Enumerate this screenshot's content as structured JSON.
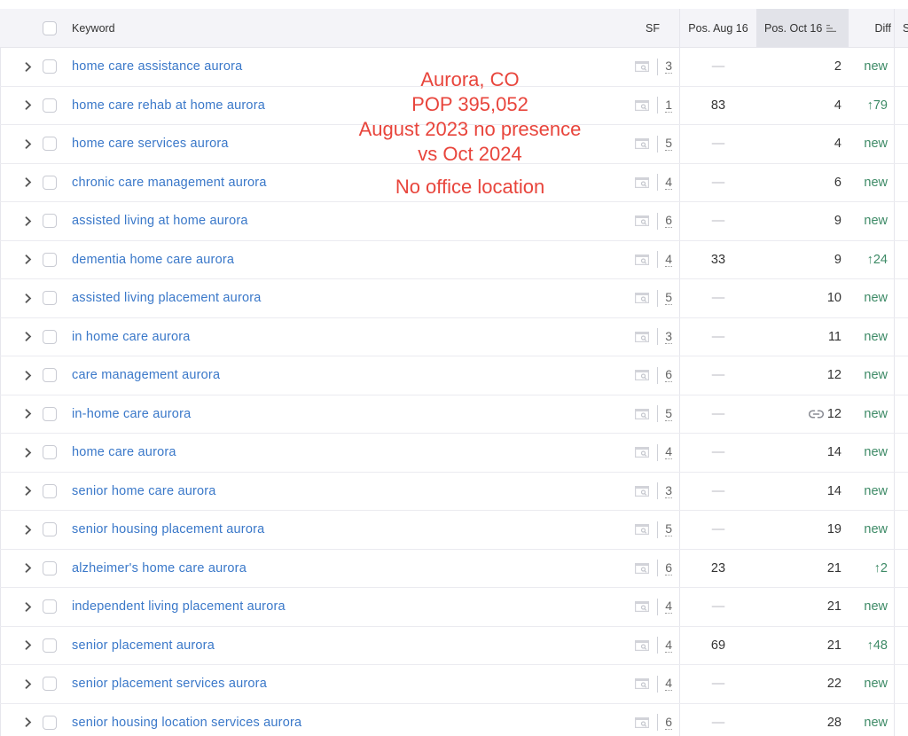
{
  "header": {
    "keyword": "Keyword",
    "sf": "SF",
    "pos_prev": "Pos. Aug 16",
    "pos_curr": "Pos. Oct 16",
    "diff": "Diff",
    "next_col": "S"
  },
  "annotation": {
    "lines": [
      "Aurora, CO",
      "POP 395,052",
      "August 2023 no presence",
      "vs Oct 2024"
    ],
    "note": "No office location",
    "color": "#e8453c"
  },
  "colors": {
    "keyword_link": "#3a78c9",
    "diff_positive": "#3d8a66",
    "header_bg": "#f4f4f8",
    "sorted_header_bg": "#e2e3e9"
  },
  "rows": [
    {
      "keyword": "home care assistance aurora",
      "sf": "3",
      "prev": "—",
      "curr": "2",
      "diff": "new",
      "link": false
    },
    {
      "keyword": "home care rehab at home aurora",
      "sf": "1",
      "prev": "83",
      "curr": "4",
      "diff": "↑79",
      "link": false
    },
    {
      "keyword": "home care services aurora",
      "sf": "5",
      "prev": "—",
      "curr": "4",
      "diff": "new",
      "link": false
    },
    {
      "keyword": "chronic care management aurora",
      "sf": "4",
      "prev": "—",
      "curr": "6",
      "diff": "new",
      "link": false
    },
    {
      "keyword": "assisted living at home aurora",
      "sf": "6",
      "prev": "—",
      "curr": "9",
      "diff": "new",
      "link": false
    },
    {
      "keyword": "dementia home care aurora",
      "sf": "4",
      "prev": "33",
      "curr": "9",
      "diff": "↑24",
      "link": false
    },
    {
      "keyword": "assisted living placement aurora",
      "sf": "5",
      "prev": "—",
      "curr": "10",
      "diff": "new",
      "link": false
    },
    {
      "keyword": "in home care aurora",
      "sf": "3",
      "prev": "—",
      "curr": "11",
      "diff": "new",
      "link": false
    },
    {
      "keyword": "care management aurora",
      "sf": "6",
      "prev": "—",
      "curr": "12",
      "diff": "new",
      "link": false
    },
    {
      "keyword": "in-home care aurora",
      "sf": "5",
      "prev": "—",
      "curr": "12",
      "diff": "new",
      "link": true
    },
    {
      "keyword": "home care aurora",
      "sf": "4",
      "prev": "—",
      "curr": "14",
      "diff": "new",
      "link": false
    },
    {
      "keyword": "senior home care aurora",
      "sf": "3",
      "prev": "—",
      "curr": "14",
      "diff": "new",
      "link": false
    },
    {
      "keyword": "senior housing placement aurora",
      "sf": "5",
      "prev": "—",
      "curr": "19",
      "diff": "new",
      "link": false
    },
    {
      "keyword": "alzheimer's home care aurora",
      "sf": "6",
      "prev": "23",
      "curr": "21",
      "diff": "↑2",
      "link": false
    },
    {
      "keyword": "independent living placement aurora",
      "sf": "4",
      "prev": "—",
      "curr": "21",
      "diff": "new",
      "link": false
    },
    {
      "keyword": "senior placement aurora",
      "sf": "4",
      "prev": "69",
      "curr": "21",
      "diff": "↑48",
      "link": false
    },
    {
      "keyword": "senior placement services aurora",
      "sf": "4",
      "prev": "—",
      "curr": "22",
      "diff": "new",
      "link": false
    },
    {
      "keyword": "senior housing location services aurora",
      "sf": "6",
      "prev": "—",
      "curr": "28",
      "diff": "new",
      "link": false
    }
  ]
}
